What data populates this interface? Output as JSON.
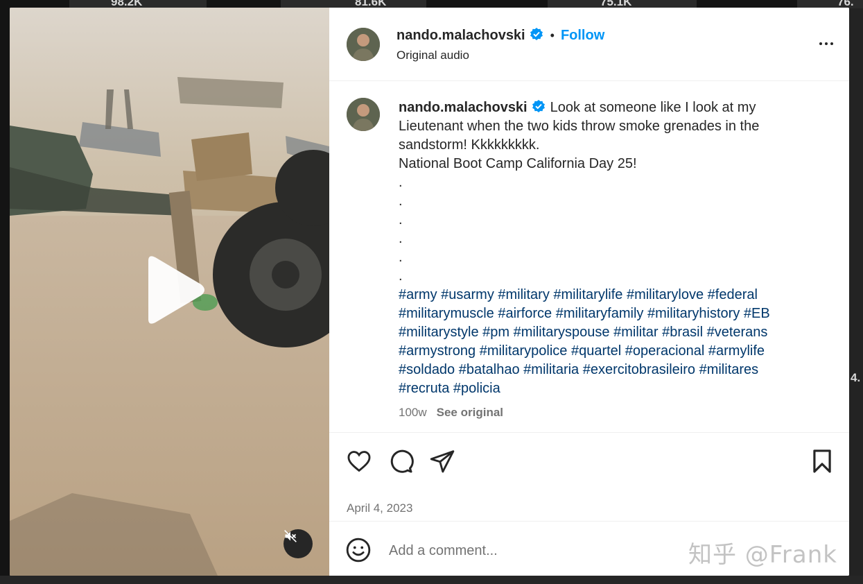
{
  "background": {
    "view_counts": [
      "98.2K",
      "81.6K",
      "75.1K",
      "76."
    ],
    "side_count": "4."
  },
  "post": {
    "author": "nando.malachovski",
    "follow_label": "Follow",
    "separator": "•",
    "audio": "Original audio",
    "caption_lines": [
      "Look at someone like I look at my",
      "Lieutenant when the two kids throw smoke grenades in the",
      "sandstorm! Kkkkkkkkk.",
      "National Boot Camp California Day 25!"
    ],
    "dots": [
      ".",
      ".",
      ".",
      ".",
      ".",
      "."
    ],
    "hashtag_lines": [
      "#army #usarmy #military #militarylife #militarylove #federal",
      "#militarymuscle #airforce #militaryfamily #militaryhistory #EB",
      "#militarystyle #pm #militaryspouse #militar #brasil #veterans",
      "#armystrong #militarypolice #quartel #operacional #armylife",
      "#soldado #batalhao #militaria #exercitobrasileiro #militares",
      "#recruta #policia"
    ],
    "age": "100w",
    "see_original": "See original",
    "date": "April 4, 2023"
  },
  "comment": {
    "placeholder": "Add a comment..."
  },
  "watermark": "知乎 @Frank",
  "icons": {
    "verified": "verified-badge-icon",
    "more": "more-options-icon",
    "like": "heart-icon",
    "comment": "comment-bubble-icon",
    "share": "paper-plane-icon",
    "save": "bookmark-icon",
    "emoji": "smiley-icon",
    "play": "play-icon",
    "mute": "speaker-muted-icon"
  },
  "colors": {
    "link": "#0095f6",
    "hashtag": "#00376b",
    "text": "#262626",
    "muted": "#737373"
  }
}
